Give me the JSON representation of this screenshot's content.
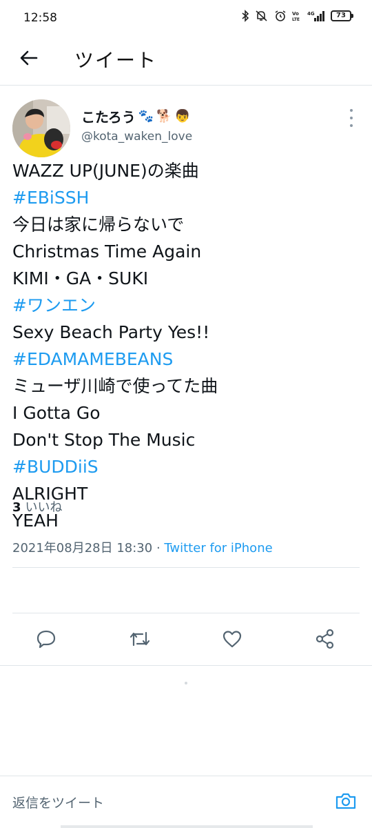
{
  "status_bar": {
    "time": "12:58",
    "battery": "73",
    "network": "4G"
  },
  "header": {
    "title": "ツイート",
    "back_icon": "arrow-left-icon"
  },
  "tweet": {
    "display_name": "こたろう",
    "name_emojis": [
      "🐾",
      "🐕",
      "👦"
    ],
    "handle": "@kota_waken_love",
    "lines": [
      {
        "text": "WAZZ UP(JUNE)の楽曲",
        "hashtag": false
      },
      {
        "text": "#EBiSSH",
        "hashtag": true
      },
      {
        "text": "今日は家に帰らないで",
        "hashtag": false
      },
      {
        "text": "Christmas Time Again",
        "hashtag": false
      },
      {
        "text": "KIMI・GA・SUKI",
        "hashtag": false
      },
      {
        "text": "#ワンエン",
        "hashtag": true
      },
      {
        "text": "Sexy Beach Party Yes!!",
        "hashtag": false
      },
      {
        "text": "#EDAMAMEBEANS",
        "hashtag": true
      },
      {
        "text": "ミューザ川崎で使ってた曲",
        "hashtag": false
      },
      {
        "text": "I Gotta Go",
        "hashtag": false
      },
      {
        "text": "Don't Stop The Music",
        "hashtag": false
      },
      {
        "text": "#BUDDiiS",
        "hashtag": true
      },
      {
        "text": "ALRIGHT",
        "hashtag": false
      },
      {
        "text": "YEAH",
        "hashtag": false
      }
    ],
    "timestamp": "2021年08月28日 18:30",
    "separator": " · ",
    "source": "Twitter for iPhone",
    "likes_count": "3",
    "likes_label": "いいね"
  },
  "actions": [
    {
      "name": "reply-icon"
    },
    {
      "name": "retweet-icon"
    },
    {
      "name": "like-icon"
    },
    {
      "name": "share-icon"
    }
  ],
  "reply": {
    "placeholder": "返信をツイート",
    "camera_icon": "camera-icon"
  },
  "colors": {
    "accent": "#1d9bf0",
    "text": "#0f1419",
    "secondary": "#536471",
    "divider": "#dfe5e9"
  }
}
